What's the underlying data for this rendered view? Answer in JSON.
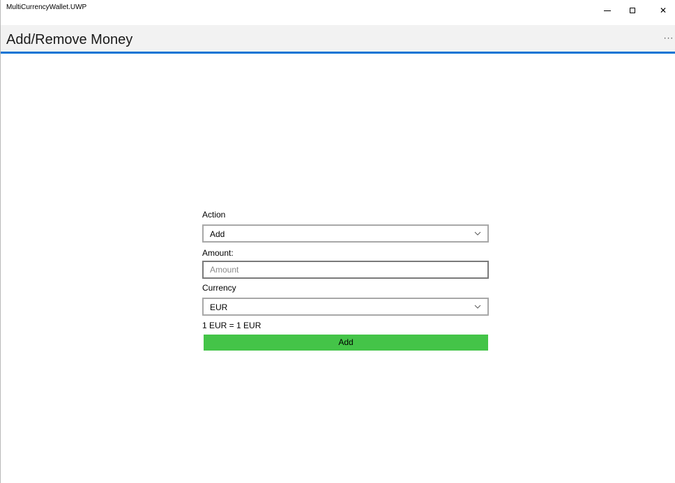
{
  "window": {
    "app_title": "MultiCurrencyWallet.UWP",
    "minimize_icon": "minimize-icon",
    "maximize_icon": "maximize-icon",
    "close_glyph": "✕"
  },
  "header": {
    "title": "Add/Remove Money",
    "more_glyph": "···",
    "accent_color": "#0a74d4"
  },
  "form": {
    "action_label": "Action",
    "action_selected": "Add",
    "amount_label": "Amount:",
    "amount_value": "",
    "amount_placeholder": "Amount",
    "currency_label": "Currency",
    "currency_selected": "EUR",
    "rate_text": "1 EUR = 1 EUR",
    "submit_label": "Add",
    "submit_color": "#44c448"
  }
}
